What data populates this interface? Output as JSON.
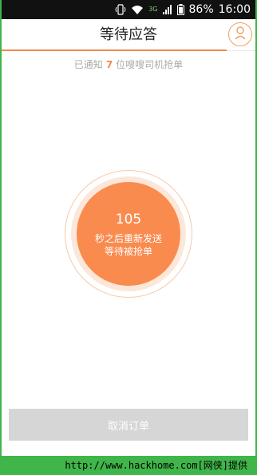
{
  "status_bar": {
    "network": "3G",
    "battery": "86%",
    "time": "16:00"
  },
  "header": {
    "title": "等待应答",
    "avatar_icon": "user-avatar-icon"
  },
  "notice": {
    "prefix": "已通知",
    "count": "7",
    "suffix": "位嗖嗖司机抢单"
  },
  "countdown": {
    "seconds": "105",
    "line1": "秒之后重新发送",
    "line2": "等待被抢单"
  },
  "actions": {
    "cancel_label": "取消订单"
  },
  "watermark": "http://www.hackhome.com[网侠]提供",
  "colors": {
    "accent": "#f98b4f",
    "frame": "#3fb54a"
  }
}
